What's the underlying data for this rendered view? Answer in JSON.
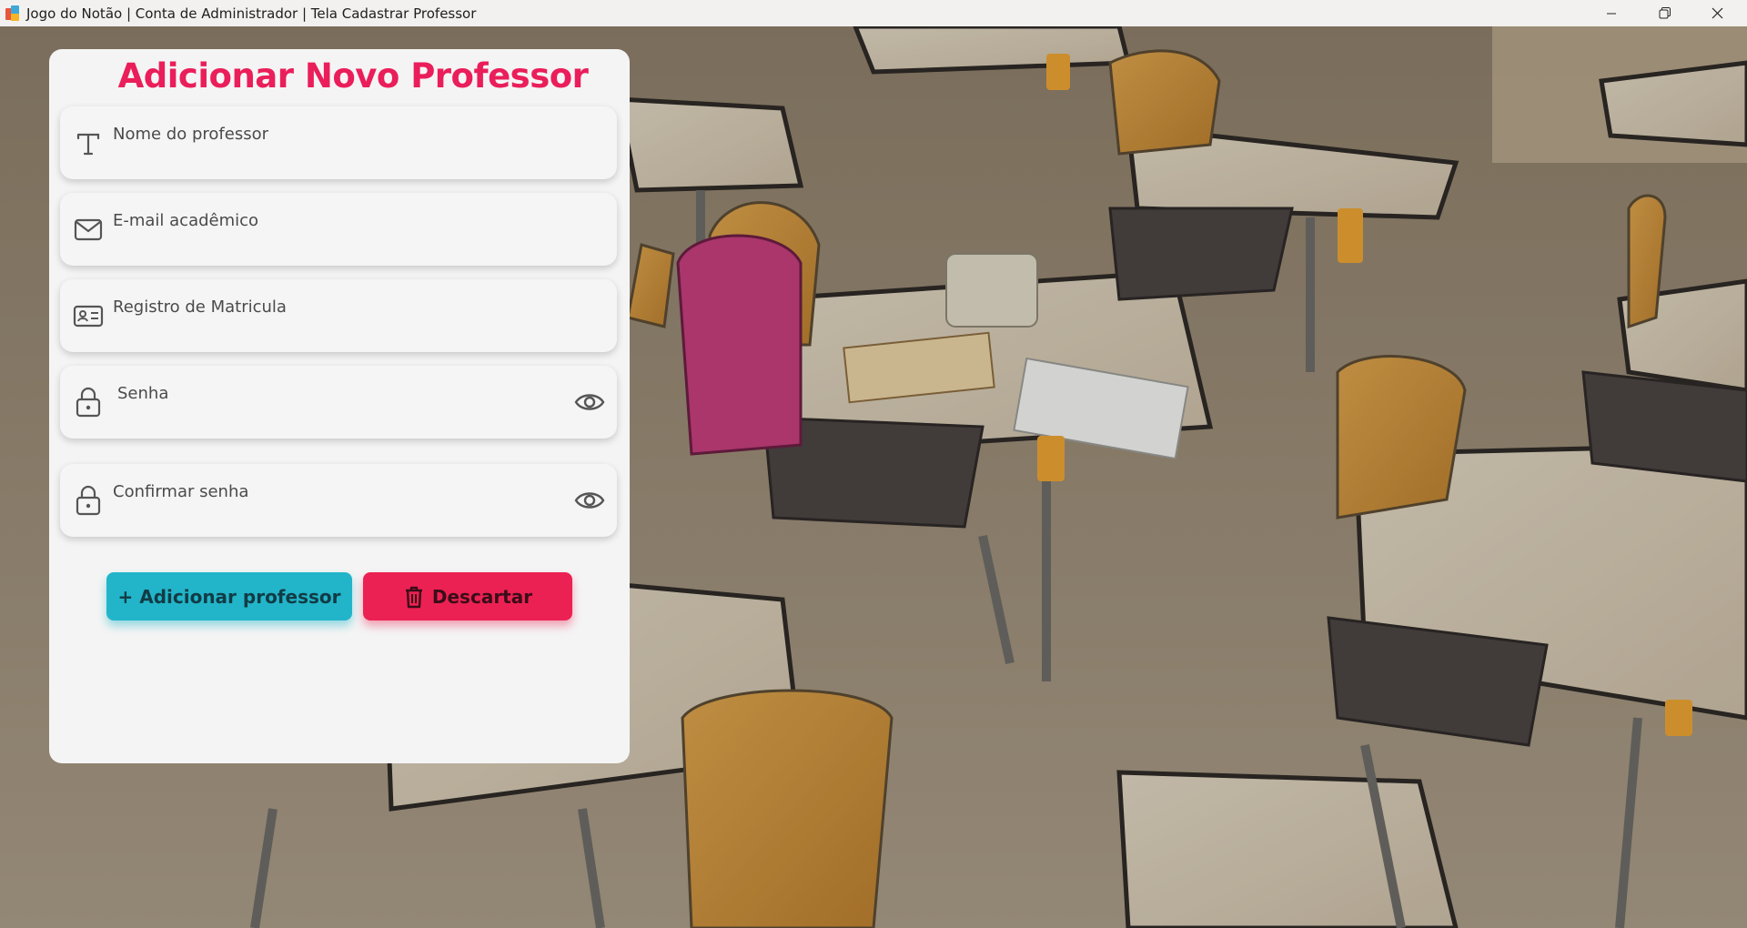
{
  "window": {
    "title": "Jogo do Notão | Conta de Administrador | Tela Cadastrar Professor",
    "minimize": "—",
    "maximize": "❐",
    "close": "✕"
  },
  "form": {
    "title": "Adicionar Novo Professor",
    "fields": [
      {
        "placeholder": "Nome do professor",
        "icon": "text-icon"
      },
      {
        "placeholder": "E-mail acadêmico",
        "icon": "mail-icon"
      },
      {
        "placeholder": "Registro de Matricula",
        "icon": "id-card-icon"
      },
      {
        "placeholder": "Senha",
        "icon": "lock-icon"
      },
      {
        "placeholder": "Confirmar senha",
        "icon": "lock-icon"
      }
    ],
    "add_button": "+ Adicionar professor",
    "discard_button": "Descartar"
  },
  "colors": {
    "title": "#ea1e5a",
    "add_button": "#22b5c9",
    "discard_button": "#ec2153",
    "card": "#f4f4f4"
  }
}
